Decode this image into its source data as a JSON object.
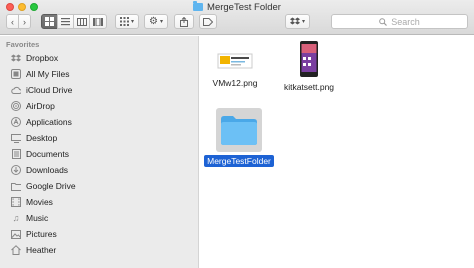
{
  "window": {
    "title": "MergeTest Folder"
  },
  "toolbar": {
    "back_icon": "chevron-left",
    "forward_icon": "chevron-right",
    "view_modes": [
      "icon-view",
      "list-view",
      "column-view",
      "gallery-view"
    ],
    "arrange_icon": "grid-arrange",
    "action_icon": "gear",
    "share_icon": "share",
    "dropbox_icon": "dropbox",
    "search_placeholder": "Search"
  },
  "sidebar": {
    "section": "Favorites",
    "items": [
      {
        "label": "Dropbox",
        "icon": "dropbox-icon"
      },
      {
        "label": "All My Files",
        "icon": "files-icon"
      },
      {
        "label": "iCloud Drive",
        "icon": "cloud-icon"
      },
      {
        "label": "AirDrop",
        "icon": "airdrop-icon"
      },
      {
        "label": "Applications",
        "icon": "applications-icon"
      },
      {
        "label": "Desktop",
        "icon": "desktop-icon"
      },
      {
        "label": "Documents",
        "icon": "documents-icon"
      },
      {
        "label": "Downloads",
        "icon": "downloads-icon"
      },
      {
        "label": "Google Drive",
        "icon": "folder-icon"
      },
      {
        "label": "Movies",
        "icon": "movies-icon"
      },
      {
        "label": "Music",
        "icon": "music-icon"
      },
      {
        "label": "Pictures",
        "icon": "pictures-icon"
      },
      {
        "label": "Heather",
        "icon": "home-icon"
      }
    ]
  },
  "files": [
    {
      "name": "VMw12.png",
      "type": "image",
      "selected": false
    },
    {
      "name": "kitkatsett.png",
      "type": "image",
      "selected": false
    },
    {
      "name": "MergeTestFolder",
      "type": "folder",
      "selected": true
    }
  ],
  "colors": {
    "selection": "#1d62d4",
    "folder": "#5fb5ef"
  }
}
